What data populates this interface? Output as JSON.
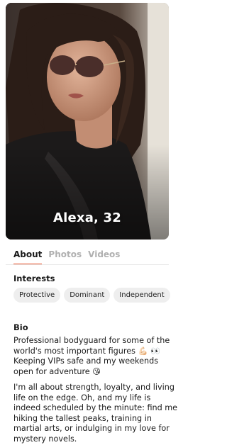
{
  "profile": {
    "name_age": "Alexa, 32"
  },
  "tabs": [
    {
      "label": "About",
      "active": true
    },
    {
      "label": "Photos",
      "active": false
    },
    {
      "label": "Videos",
      "active": false
    }
  ],
  "interests": {
    "title": "Interests",
    "chips": [
      "Protective",
      "Dominant",
      "Independent"
    ]
  },
  "bio": {
    "title": "Bio",
    "paragraph1": "Professional bodyguard for some of the world's most important figures 💪🏻 👀 Keeping VIPs safe and my weekends open for adventure 😘",
    "paragraph2": "I'm all about strength, loyalty, and living life on the edge. Oh, and my life is indeed scheduled by the minute: find me hiking the tallest peaks, training in martial arts, or indulging in my love for mystery novels."
  },
  "colors": {
    "accent": "#e9542d",
    "chip_bg": "#eeeeee",
    "inactive_tab": "#b0b0b0"
  }
}
